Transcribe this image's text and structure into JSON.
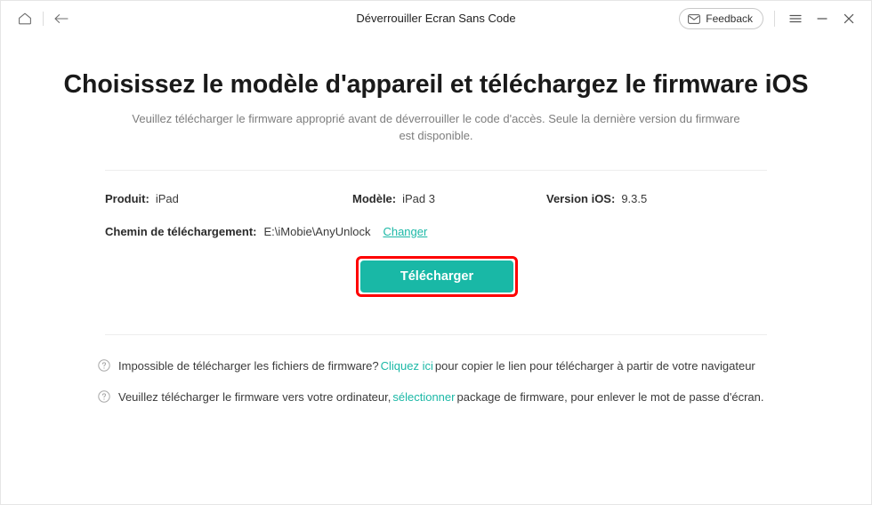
{
  "titlebar": {
    "home_icon": "home-icon",
    "back_icon": "back-arrow-icon",
    "title": "Déverrouiller Ecran Sans Code",
    "feedback_label": "Feedback",
    "feedback_icon": "envelope-icon",
    "menu_icon": "hamburger-menu-icon",
    "minimize_icon": "minimize-icon",
    "close_icon": "close-icon"
  },
  "main": {
    "heading": "Choisissez le modèle d'appareil et téléchargez le firmware iOS",
    "subtitle": "Veuillez télécharger le firmware approprié avant de déverrouiller le code d'accès. Seule la dernière version du firmware est disponible.",
    "info": [
      {
        "label": "Produit:",
        "value": "iPad"
      },
      {
        "label": "Modèle:",
        "value": "iPad 3"
      },
      {
        "label": "Version iOS:",
        "value": "9.3.5"
      }
    ],
    "path": {
      "label": "Chemin de téléchargement:",
      "value": "E:\\iMobie\\AnyUnlock",
      "change_link": "Changer"
    },
    "download_button": "Télécharger"
  },
  "hints": [
    {
      "icon": "question-circle-icon",
      "before": "Impossible de télécharger les fichiers de firmware?",
      "link": "Cliquez ici",
      "after": "pour copier le lien pour télécharger à partir de votre navigateur"
    },
    {
      "icon": "question-circle-icon",
      "before": "Veuillez télécharger le firmware vers votre ordinateur,",
      "link": "sélectionner",
      "after": "package de firmware, pour enlever le mot de passe d'écran."
    }
  ],
  "colors": {
    "accent_teal": "#19b8a6",
    "annotation_red": "#fe0000",
    "link_teal": "#1bb8a6"
  }
}
